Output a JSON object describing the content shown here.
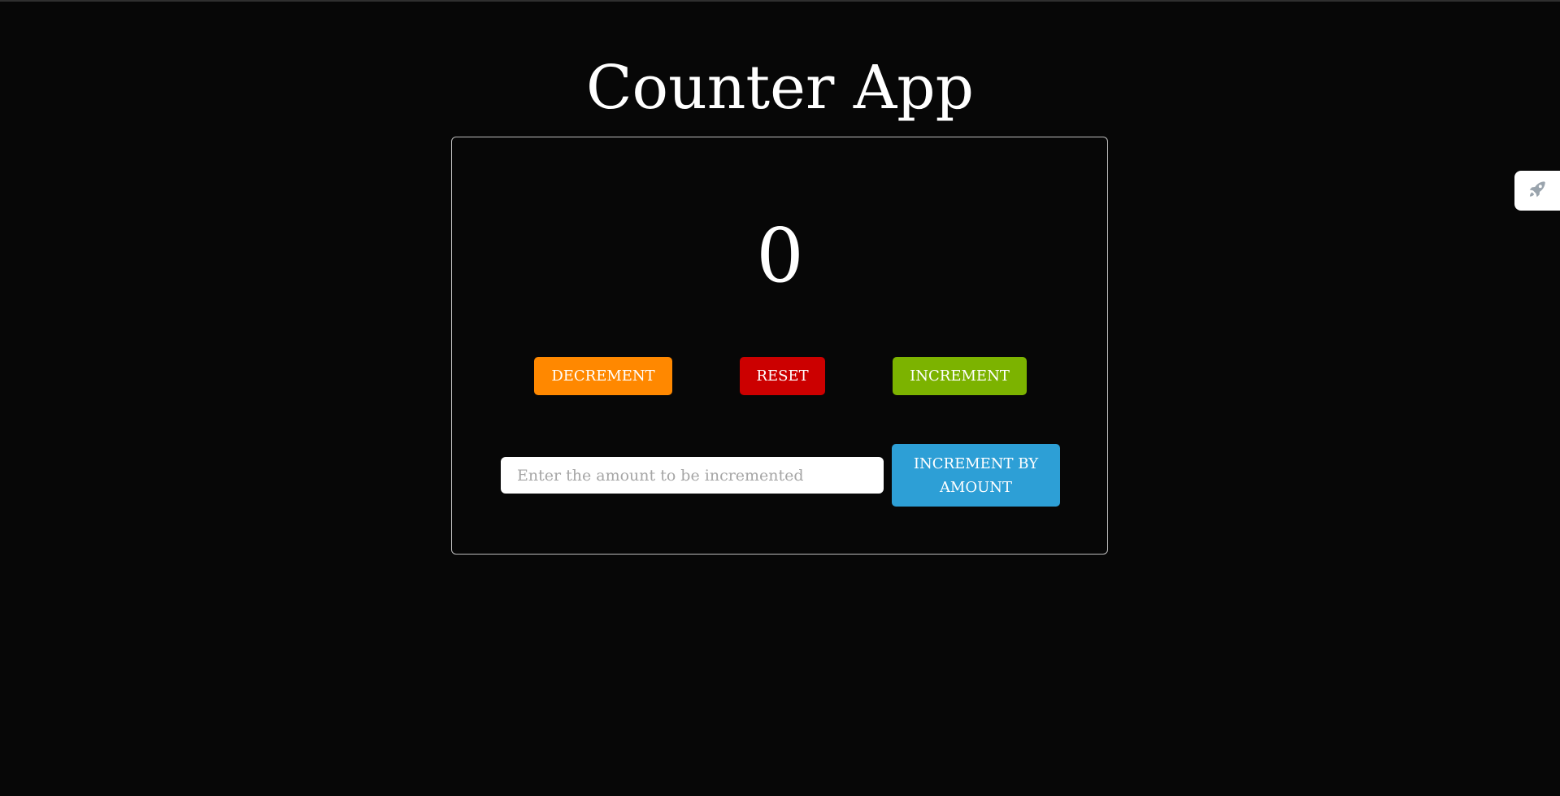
{
  "app": {
    "title": "Counter App"
  },
  "counter": {
    "value": "0"
  },
  "buttons": {
    "decrement": "DECREMENT",
    "reset": "RESET",
    "increment": "INCREMENT",
    "increment_by_amount": "INCREMENT BY AMOUNT"
  },
  "amount_input": {
    "value": "",
    "placeholder": "Enter the amount to be incremented"
  },
  "side_tab": {
    "icon": "rocket-icon"
  },
  "colors": {
    "background": "#070707",
    "decrement": "#ff8800",
    "reset": "#cc0000",
    "increment": "#7cb300",
    "increment_by_amount": "#2d9fd6",
    "side_icon": "#9aa4ad"
  }
}
